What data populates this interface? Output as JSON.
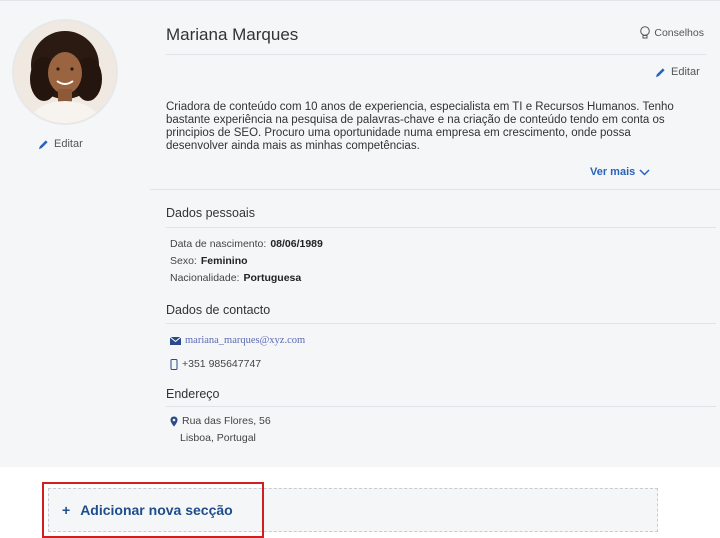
{
  "profile": {
    "name": "Mariana Marques",
    "tips_label": "Conselhos",
    "photo_edit_label": "Editar",
    "bio_edit_label": "Editar",
    "bio": "Criadora de conteúdo com 10 anos de experiencia, especialista em TI e Recursos Humanos. Tenho bastante experiência na pesquisa de palavras-chave e na criação de conteúdo tendo em conta os principios de SEO. Procuro uma oportunidade numa empresa em crescimento, onde possa desenvolver ainda mais as minhas competências.",
    "see_more_label": "Ver mais"
  },
  "personal": {
    "title": "Dados pessoais",
    "birth_label": "Data de nascimento:",
    "birth_value": "08/06/1989",
    "sex_label": "Sexo:",
    "sex_value": "Feminino",
    "nationality_label": "Nacionalidade:",
    "nationality_value": "Portuguesa"
  },
  "contact": {
    "title": "Dados de contacto",
    "email": "mariana_marques@xyz.com",
    "phone": "+351 985647747"
  },
  "address": {
    "title": "Endereço",
    "line1": "Rua das Flores, 56",
    "line2": "Lisboa, Portugal"
  },
  "add_section": {
    "icon": "+",
    "label": "Adicionar nova secção"
  },
  "colors": {
    "accent": "#2a63b8",
    "highlight_border": "#d11f1f",
    "card_background": "#f5f6f8"
  }
}
